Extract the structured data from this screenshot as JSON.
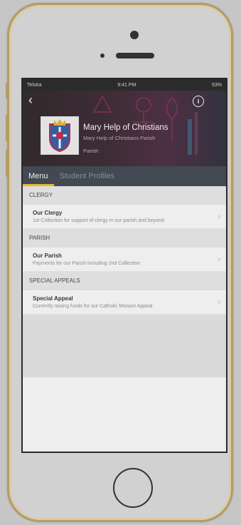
{
  "status_bar": {
    "carrier": "Telstra",
    "time": "9:41 PM",
    "battery": "53%"
  },
  "header": {
    "title": "Mary Help of Christians",
    "subtitle": "Mary Help of Christians Parish",
    "subtitle2": "Parish"
  },
  "tabs": [
    {
      "label": "Menu",
      "active": true
    },
    {
      "label": "Student Profiles",
      "active": false
    }
  ],
  "sections": [
    {
      "heading": "CLERGY",
      "rows": [
        {
          "title": "Our Clergy",
          "desc": "1st Collection for support of clergy in our parish and beyond"
        }
      ]
    },
    {
      "heading": "PARISH",
      "rows": [
        {
          "title": "Our Parish",
          "desc": "Payments for our Parish including 2nd Collection"
        }
      ]
    },
    {
      "heading": "SPECIAL APPEALS",
      "rows": [
        {
          "title": "Special Appeal",
          "desc": "Currently raising funds for our Catholic Mission Appeal"
        }
      ]
    }
  ],
  "icons": {
    "back": "chevron-left-icon",
    "info": "info-icon",
    "row_chevron": "chevron-right-icon"
  },
  "colors": {
    "tab_bar": "#2e3641",
    "tab_indicator": "#f1c40f",
    "phone_trim": "#b89b5a"
  }
}
